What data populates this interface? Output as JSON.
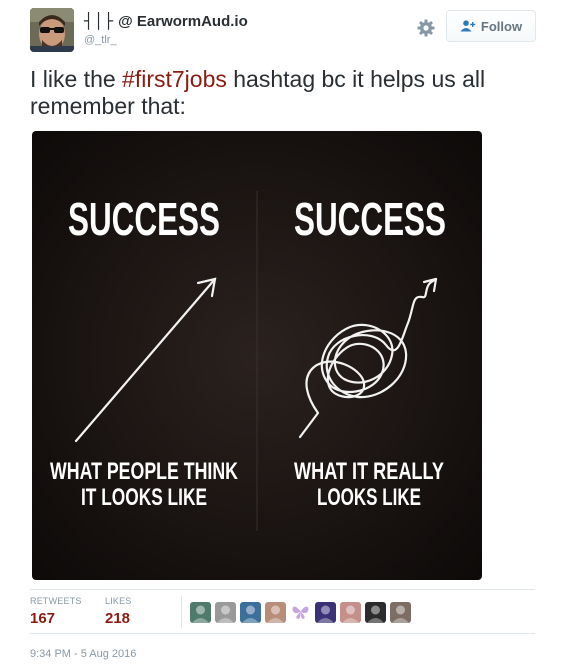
{
  "author": {
    "name_glyphs": "┤│├",
    "name": "@ EarwormAud.io",
    "handle": "@_tlr_",
    "avatar_icon": "user-avatar-sunglasses"
  },
  "actions": {
    "settings_icon": "gear-icon",
    "follow_label": "Follow",
    "follow_icon": "person-plus-icon"
  },
  "tweet": {
    "text_before": "I like the ",
    "hashtag": "#first7jobs",
    "text_after": " hashtag bc it helps us all remember that:"
  },
  "media": {
    "left_title": "SUCCESS",
    "right_title": "SUCCESS",
    "left_caption_line1": "WHAT PEOPLE THINK",
    "left_caption_line2": "IT LOOKS LIKE",
    "right_caption_line1": "WHAT IT REALLY",
    "right_caption_line2": "LOOKS LIKE",
    "left_graphic": "straight-arrow-up",
    "right_graphic": "tangled-arrow-up"
  },
  "stats": {
    "retweets_label": "RETWEETS",
    "retweets_value": "167",
    "likes_label": "LIKES",
    "likes_value": "218"
  },
  "likers": [
    {
      "icon": "liker-avatar",
      "color": "#4f7a6c"
    },
    {
      "icon": "liker-avatar",
      "color": "#9a9a9a"
    },
    {
      "icon": "liker-avatar",
      "color": "#3c6f9c"
    },
    {
      "icon": "liker-avatar",
      "color": "#b88d7a"
    },
    {
      "icon": "butterfly-avatar",
      "color": "#c7a3e0"
    },
    {
      "icon": "liker-avatar",
      "color": "#3a3176"
    },
    {
      "icon": "liker-avatar",
      "color": "#c58f8b"
    },
    {
      "icon": "liker-avatar",
      "color": "#2c2c2c"
    },
    {
      "icon": "liker-avatar",
      "color": "#7d6e65"
    }
  ],
  "timestamp": "9:34 PM - 5 Aug 2016",
  "colors": {
    "link": "#8a1c12",
    "muted": "#8899a6",
    "text": "#292f33",
    "border": "#e1e8ed"
  }
}
